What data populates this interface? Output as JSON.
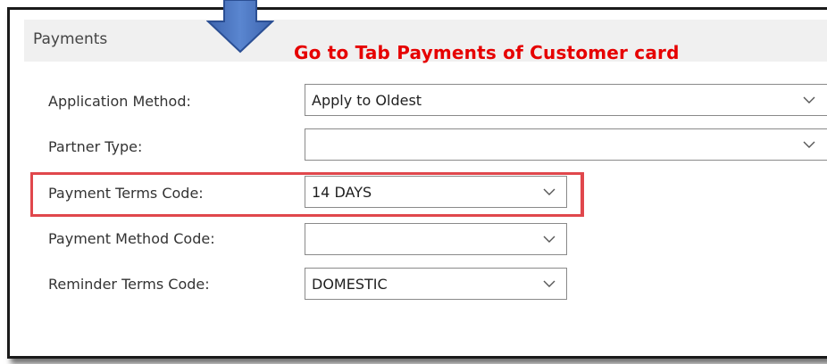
{
  "section": {
    "title": "Payments"
  },
  "annotation": {
    "text": "Go to Tab Payments of Customer card",
    "color": "#e60000"
  },
  "highlight": {
    "color": "#e0474c"
  },
  "arrow": {
    "icon": "arrow-down-icon",
    "color": "#4a74c0"
  },
  "fields": [
    {
      "label": "Application Method:",
      "value": "Apply to Oldest"
    },
    {
      "label": "Partner Type:",
      "value": ""
    },
    {
      "label": "Payment Terms Code:",
      "value": "14 DAYS"
    },
    {
      "label": "Payment Method Code:",
      "value": ""
    },
    {
      "label": "Reminder Terms Code:",
      "value": "DOMESTIC"
    }
  ]
}
